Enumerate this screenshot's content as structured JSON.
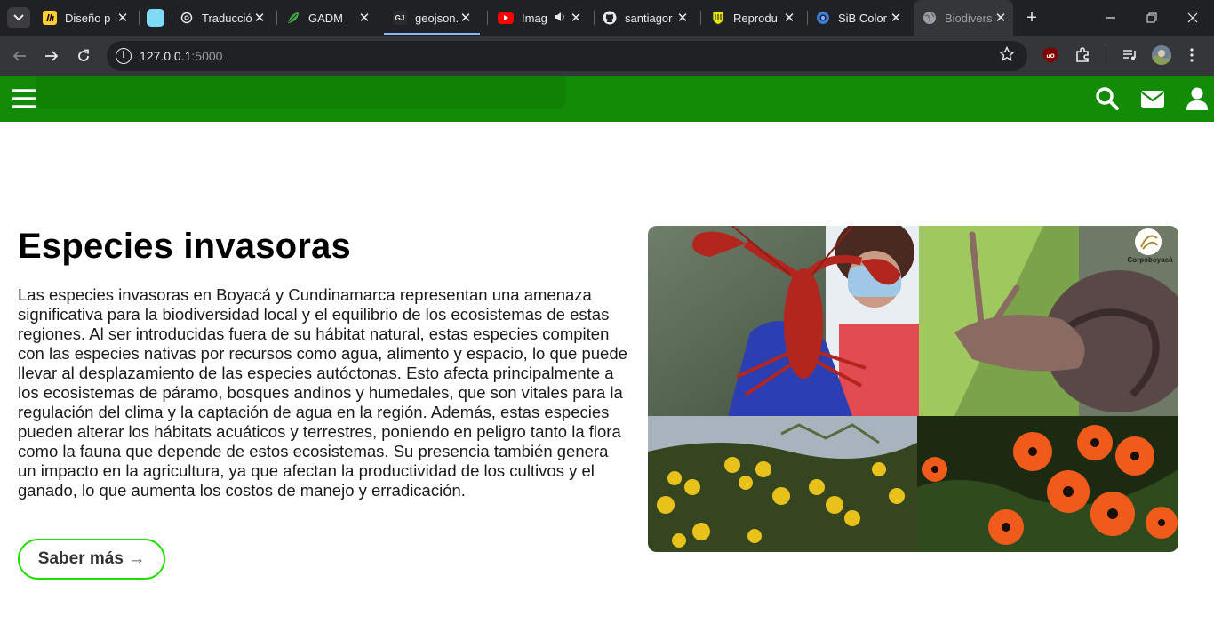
{
  "browser": {
    "tabs": [
      {
        "title": "Diseño p",
        "favicon": "miro-icon",
        "color": "#ffd02f"
      },
      {
        "title": "",
        "favicon": "app-icon",
        "color": "#7fdbf5"
      },
      {
        "title": "Traducció",
        "favicon": "openai-icon",
        "color": "#e8eaed"
      },
      {
        "title": "GADM",
        "favicon": "leaf-icon",
        "color": "#3fae49"
      },
      {
        "title": "geojson.",
        "favicon": "geojson-icon",
        "color": "#2b2b2b"
      },
      {
        "title": "Imag",
        "favicon": "youtube-icon",
        "color": "#ff0000"
      },
      {
        "title": "santiagor",
        "favicon": "github-icon",
        "color": "#e8eaed"
      },
      {
        "title": "Reprodu",
        "favicon": "shield-icon",
        "color": "#e6e600"
      },
      {
        "title": "SiB Color",
        "favicon": "sib-icon",
        "color": "#3a7bd5"
      },
      {
        "title": "Biodivers",
        "favicon": "globe-icon",
        "color": "#9aa0a6"
      }
    ],
    "url_host": "127.0.0.1",
    "url_port": ":5000"
  },
  "content": {
    "heading": "Especies invasoras",
    "paragraph": "Las especies invasoras en Boyacá y Cundinamarca representan una amenaza significativa para la biodiversidad local y el equilibrio de los ecosistemas de estas regiones. Al ser introducidas fuera de su hábitat natural, estas especies compiten con las especies nativas por recursos como agua, alimento y espacio, lo que puede llevar al desplazamiento de las especies autóctonas. Esto afecta principalmente a los ecosistemas de páramo, bosques andinos y humedales, que son vitales para la regulación del clima y la captación de agua en la región. Además, estas especies pueden alterar los hábitats acuáticos y terrestres, poniendo en peligro tanto la flora como la fauna que depende de estos ecosistemas. Su presencia también genera un impacto en la agricultura, ya que afectan la productividad de los cultivos y el ganado, lo que aumenta los costos de manejo y erradicación.",
    "button_label": "Saber más →",
    "logo_text": "Corpoboyacá"
  },
  "colors": {
    "nav_green": "#128c07",
    "button_border": "#1fe000"
  }
}
